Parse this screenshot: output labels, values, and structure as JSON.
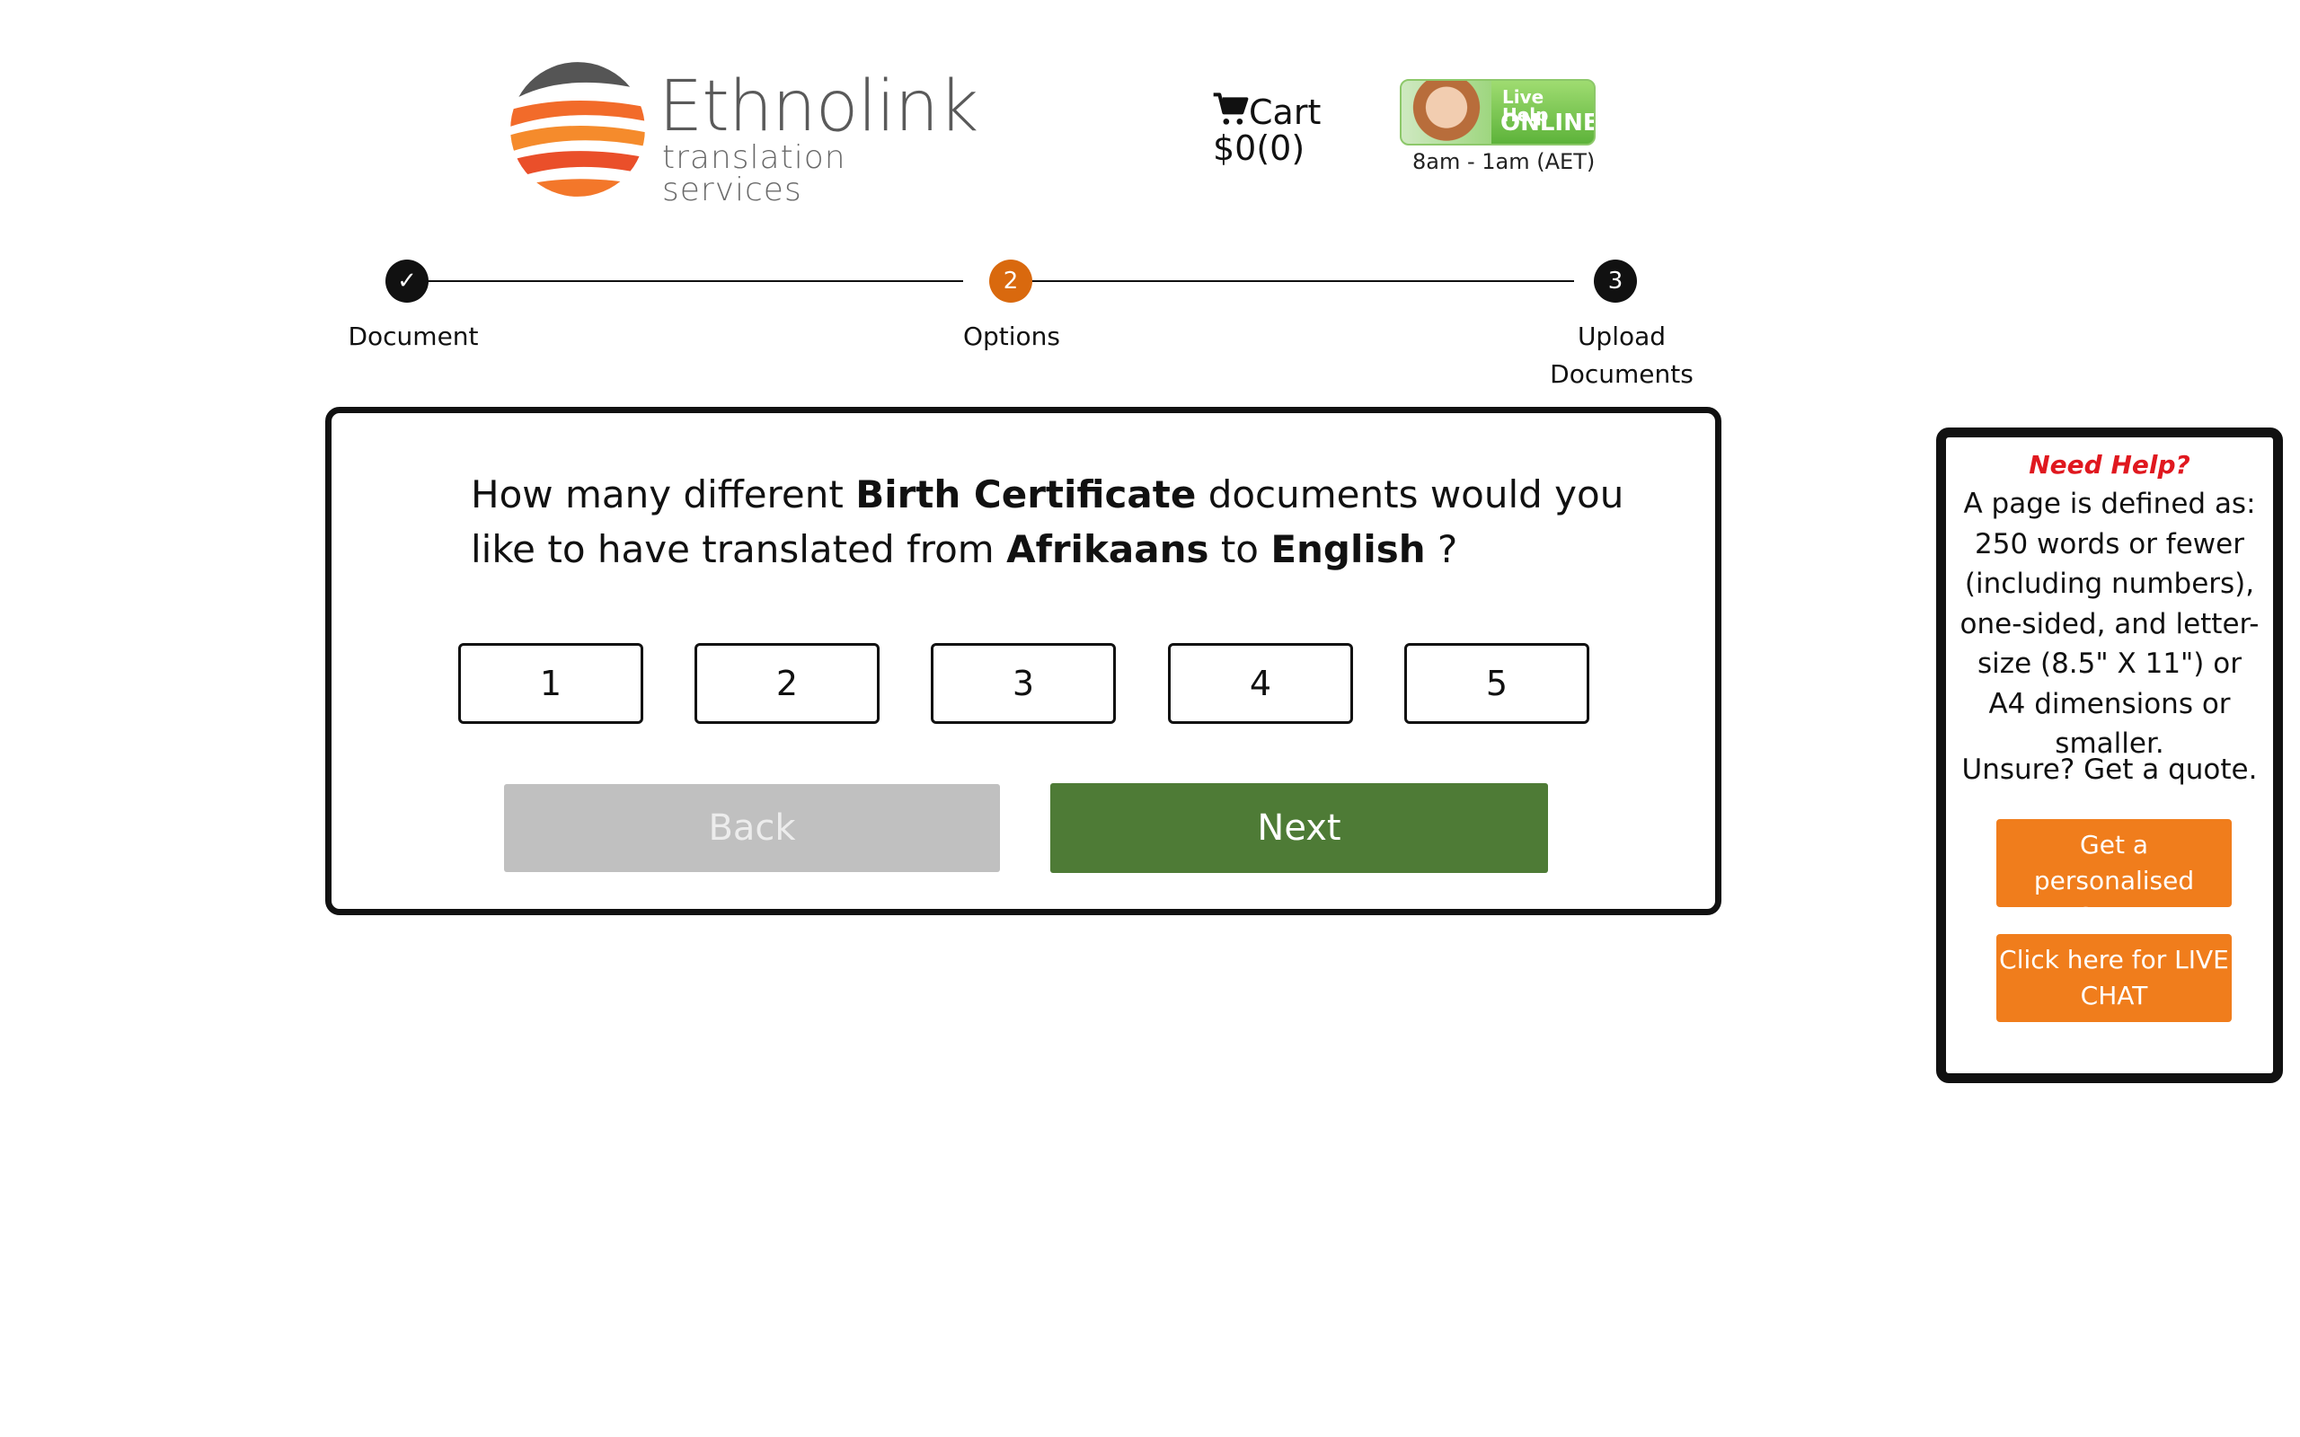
{
  "header": {
    "brand_name": "Ethnolink",
    "brand_tagline": "translation services",
    "cart_label": "Cart",
    "cart_amount": "$0(0)",
    "live_help_top": "Live Help",
    "live_help_status": "ONLINE",
    "live_help_hours": "8am - 1am (AET)",
    "icons": {
      "logo": "ethnolink-logo-icon",
      "cart": "shopping-cart-icon",
      "agent": "support-agent-avatar-icon",
      "check": "check-icon"
    }
  },
  "stepper": {
    "steps": [
      {
        "number": "✓",
        "label": "Document",
        "state": "complete",
        "color": "#111111"
      },
      {
        "number": "2",
        "label": "Options",
        "state": "active",
        "color": "#d9690e"
      },
      {
        "number": "3",
        "label": "Upload Documents",
        "state": "pending",
        "color": "#111111"
      }
    ]
  },
  "question": {
    "prefix": "How many different ",
    "document_type": "Birth Certificate",
    "middle": " documents would you like to have translated from ",
    "source_language": "Afrikaans",
    "to_word": " to ",
    "target_language": "English",
    "suffix": " ?"
  },
  "choices": [
    "1",
    "2",
    "3",
    "4",
    "5"
  ],
  "actions": {
    "back_label": "Back",
    "next_label": "Next"
  },
  "help": {
    "heading": "Need Help?",
    "body": "A page is defined as: 250 words or fewer (including numbers), one-sided, and letter-size (8.5\" X 11\") or A4 dimensions or smaller.",
    "unsure": "Unsure? Get a quote.",
    "quote_button": "Get a personalised Quote",
    "chat_button": "Click here for LIVE CHAT"
  },
  "colors": {
    "accent_orange": "#f07d1c",
    "step_active": "#d9690e",
    "next_green": "#4e7b36",
    "back_grey": "#c0c0c0",
    "help_red": "#e0181f"
  }
}
